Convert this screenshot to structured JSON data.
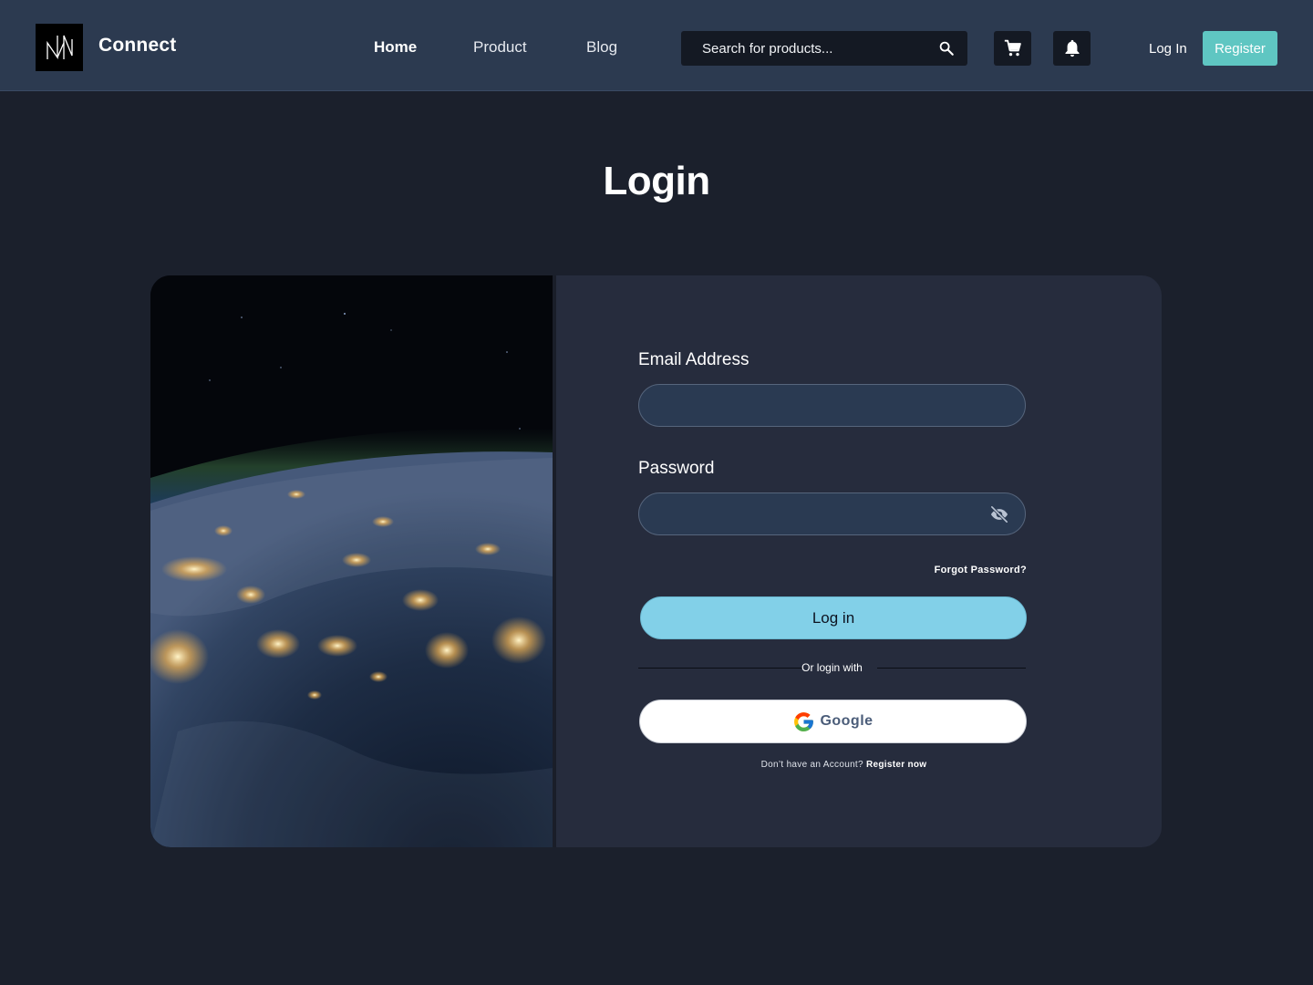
{
  "header": {
    "brand": "Connect",
    "nav": [
      "Home",
      "Product",
      "Blog"
    ],
    "active_nav": "Home",
    "search_placeholder": "Search for products...",
    "login_label": "Log In",
    "register_label": "Register",
    "icons": [
      "logo-icon",
      "search-icon",
      "cart-icon",
      "bell-icon"
    ],
    "colors": {
      "bar": "#2c3a50",
      "register": "#5fc6c2"
    }
  },
  "page": {
    "title": "Login"
  },
  "form": {
    "email_label": "Email Address",
    "email_value": "",
    "password_label": "Password",
    "password_value": "",
    "forgot_label": "Forgot Password?",
    "login_button": "Log in",
    "or_text": "Or login with",
    "google_label": "Google",
    "signup_prompt": "Don’t have an Account?",
    "signup_link": "Register now",
    "colors": {
      "login_button": "#82d0e8",
      "field": "#2a3a52"
    }
  }
}
